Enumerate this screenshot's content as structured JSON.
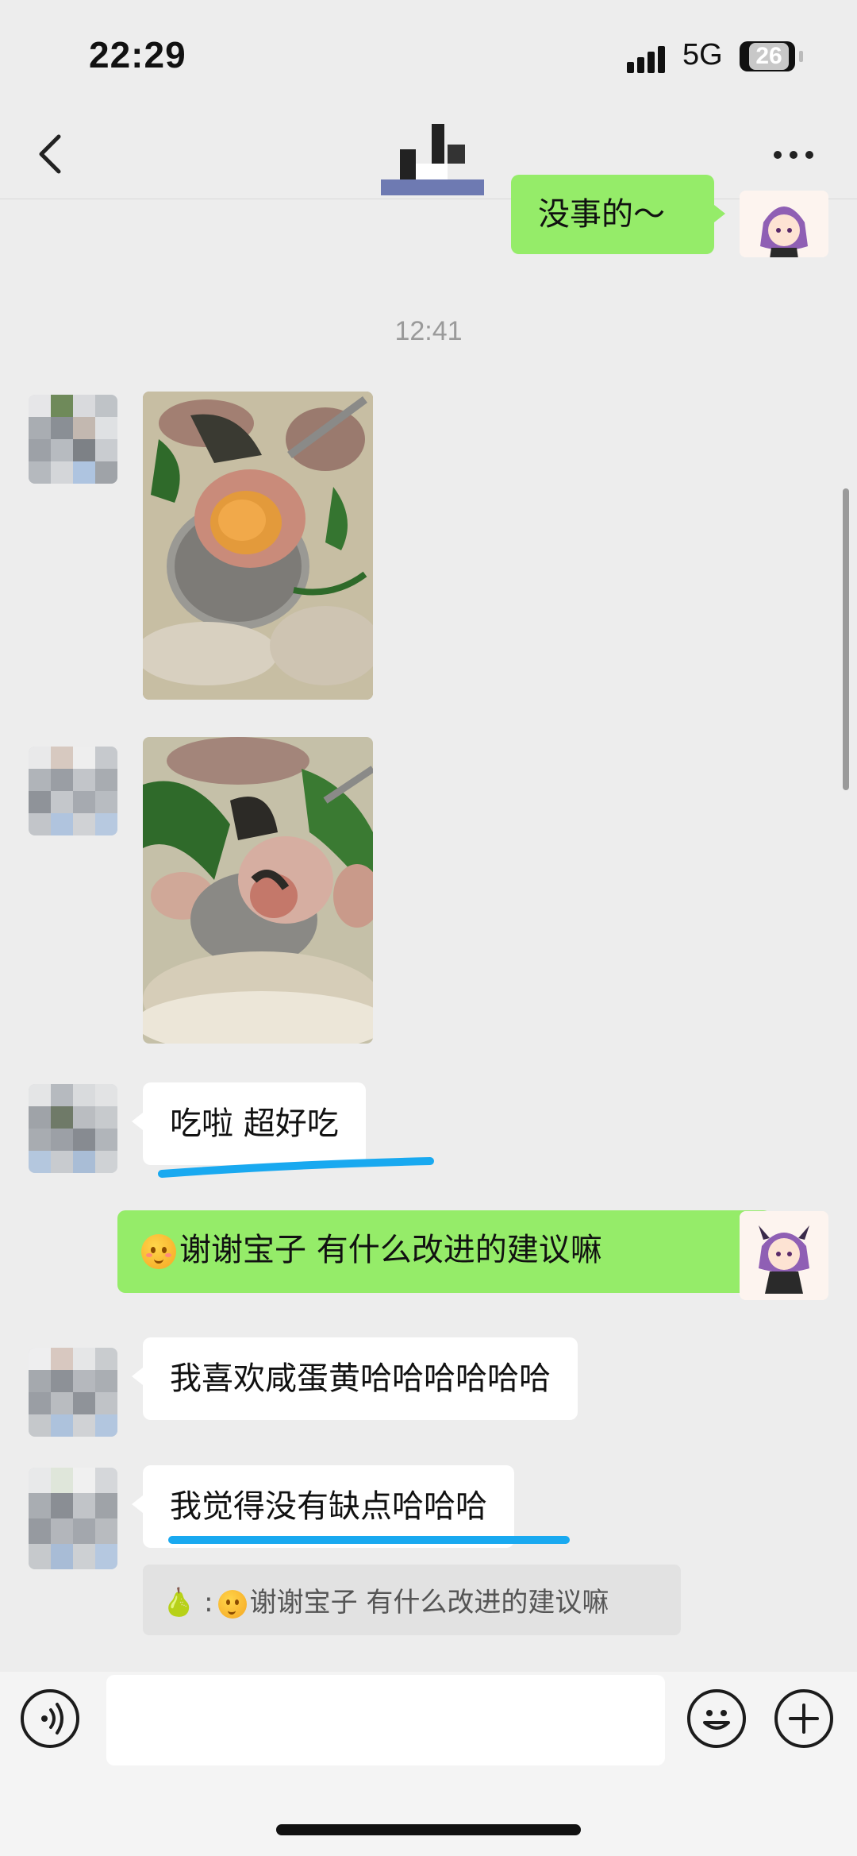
{
  "status_bar": {
    "time": "22:29",
    "network": "5G",
    "battery": "26"
  },
  "nav": {
    "title_blurred": true
  },
  "messages": {
    "m0_text": "没事的～",
    "timestamp": "12:41",
    "m3_text": "吃啦 超好吃",
    "m4_text": "谢谢宝子  有什么改进的建议嘛",
    "m5_text": "我喜欢咸蛋黄哈哈哈哈哈哈",
    "m6_text": "我觉得没有缺点哈哈哈",
    "quote_prefix": "🍐 :",
    "quote_text": "谢谢宝子  有什么改进的建议嘛"
  },
  "photos": [
    {
      "name": "wonton-with-salted-egg-yolk-photo"
    },
    {
      "name": "wonton-soup-with-seaweed-photo"
    }
  ],
  "colors": {
    "accent": "#95ec69",
    "underline": "#19a9f0",
    "background": "#ededed"
  },
  "input": {
    "placeholder": ""
  }
}
